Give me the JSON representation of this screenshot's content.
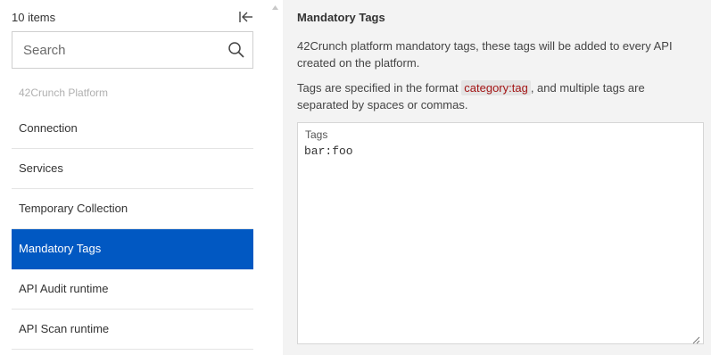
{
  "sidebar": {
    "item_count": "10 items",
    "search_placeholder": "Search",
    "group_label": "42Crunch Platform",
    "items": [
      {
        "label": "Connection",
        "active": false
      },
      {
        "label": "Services",
        "active": false
      },
      {
        "label": "Temporary Collection",
        "active": false
      },
      {
        "label": "Mandatory Tags",
        "active": true
      },
      {
        "label": "API Audit runtime",
        "active": false
      },
      {
        "label": "API Scan runtime",
        "active": false
      }
    ],
    "icons": {
      "collapse": "collapse-left-icon",
      "search": "search-icon"
    }
  },
  "main": {
    "title": "Mandatory Tags",
    "description": "42Crunch platform mandatory tags, these tags will be added to every API created on the platform.",
    "format_prefix": "Tags are specified in the format ",
    "format_code": "category:tag",
    "format_suffix": ", and multiple tags are separated by spaces or commas.",
    "tags_label": "Tags",
    "tags_value": "bar:foo"
  },
  "colors": {
    "accent": "#0158c2",
    "panel_bg": "#f3f3f3",
    "code_text": "#a31515",
    "code_bg": "#e4e4e4"
  }
}
